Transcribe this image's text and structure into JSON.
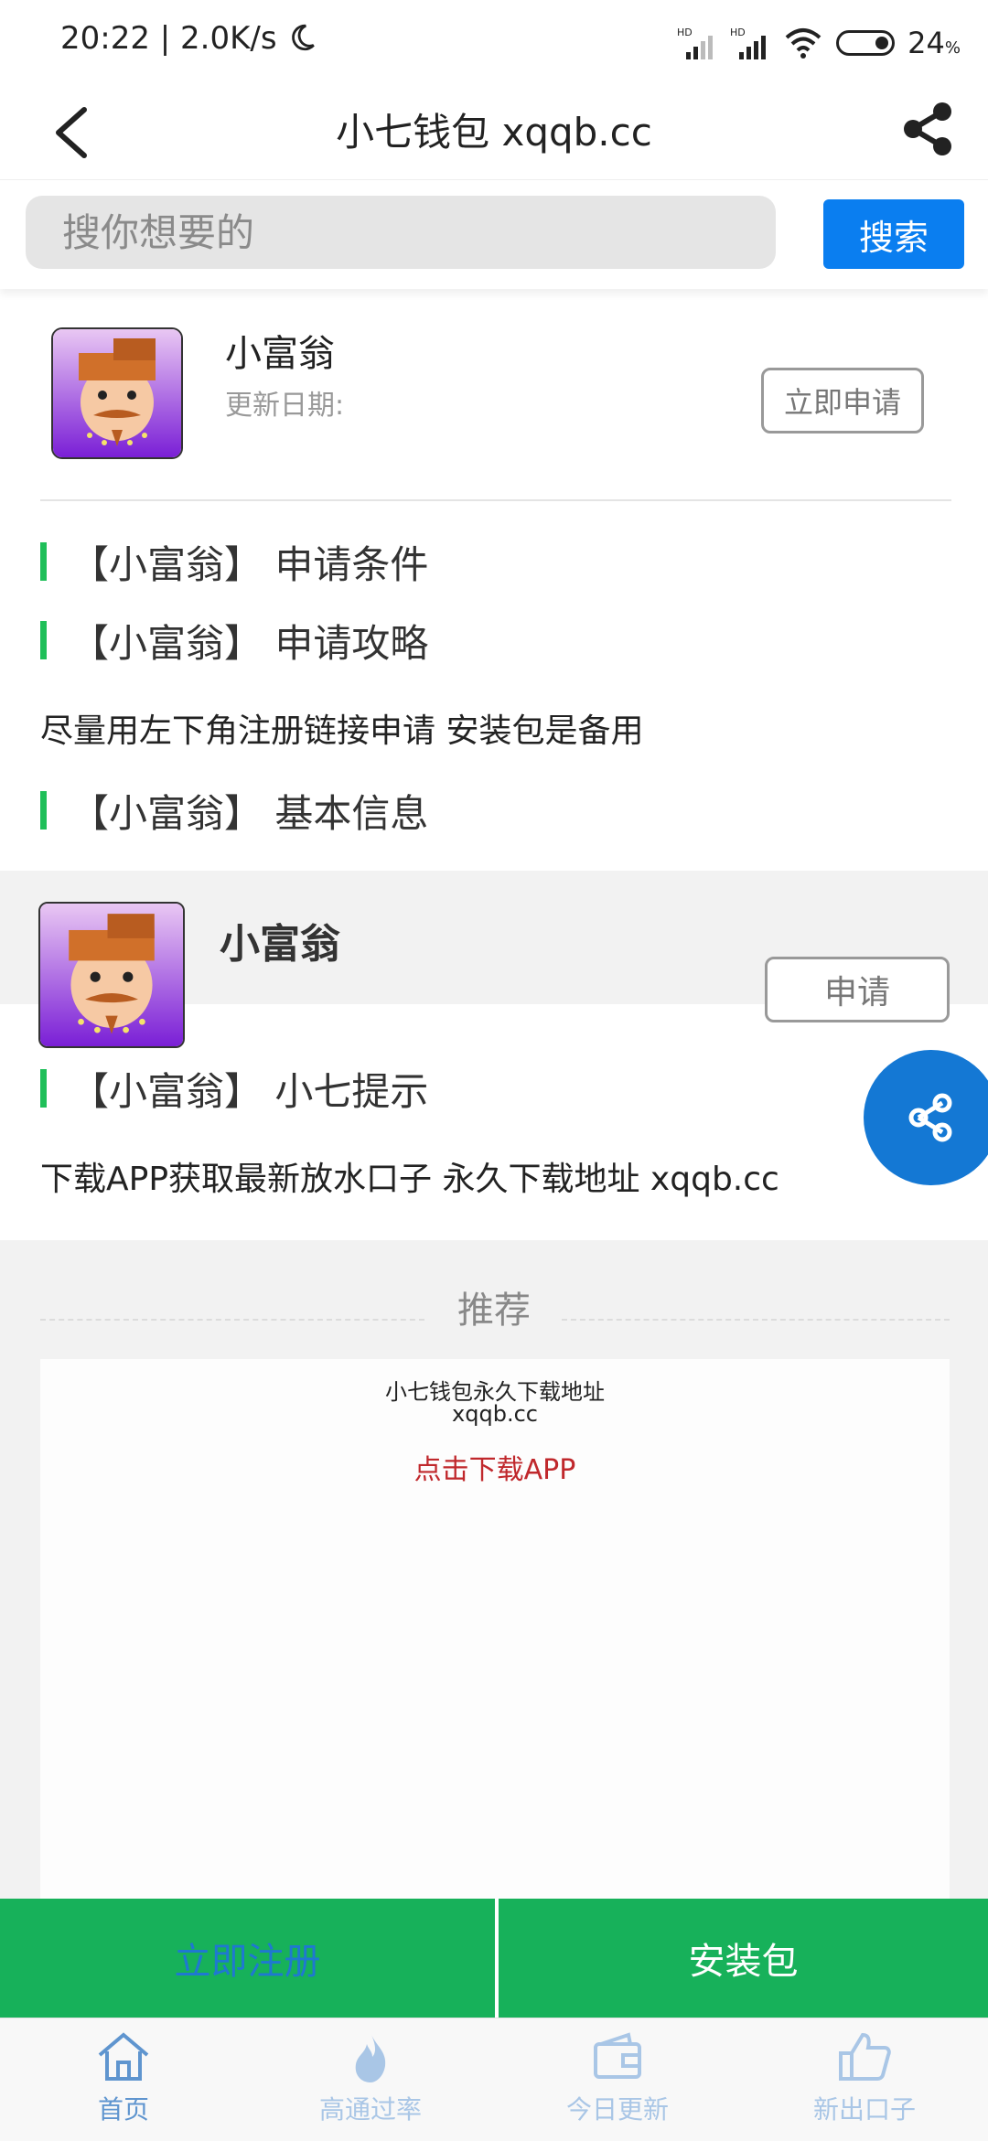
{
  "status_bar": {
    "time_speed": "20:22 | 2.0K/s",
    "net1": "HD",
    "net2": "HD",
    "battery": "24",
    "battery_unit": "%"
  },
  "header": {
    "title": "小七钱包 xqqb.cc",
    "back_icon": "back-arrow-icon",
    "share_icon": "share-icon"
  },
  "search": {
    "placeholder": "搜你想要的",
    "button_label": "搜索"
  },
  "app_card": {
    "name": "小富翁",
    "update_label": "更新日期:",
    "apply_button": "立即申请"
  },
  "sections": {
    "conditions": "【小富翁】 申请条件",
    "strategy": "【小富翁】 申请攻略",
    "strategy_text": "尽量用左下角注册链接申请 安装包是备用",
    "basic_info": "【小富翁】 基本信息",
    "tips": "【小富翁】 小七提示",
    "tips_text": "下载APP获取最新放水口子 永久下载地址 xqqb.cc"
  },
  "app_card2": {
    "name": "小富翁",
    "apply_button": "申请"
  },
  "recommend": {
    "title": "推荐",
    "line1": "小七钱包永久下载地址",
    "line2": "xqqb.cc",
    "link": "点击下载APP"
  },
  "actions": {
    "register": "立即注册",
    "install": "安装包"
  },
  "bottom_nav": [
    {
      "label": "首页",
      "icon": "home-icon"
    },
    {
      "label": "高通过率",
      "icon": "flame-icon"
    },
    {
      "label": "今日更新",
      "icon": "wallet-icon"
    },
    {
      "label": "新出口子",
      "icon": "thumbs-up-icon"
    }
  ],
  "colors": {
    "accent_blue": "#0a7ef0",
    "green": "#17b15a",
    "section_bar": "#1fbf59",
    "link_red": "#c0282c",
    "fab": "#1478d4"
  }
}
